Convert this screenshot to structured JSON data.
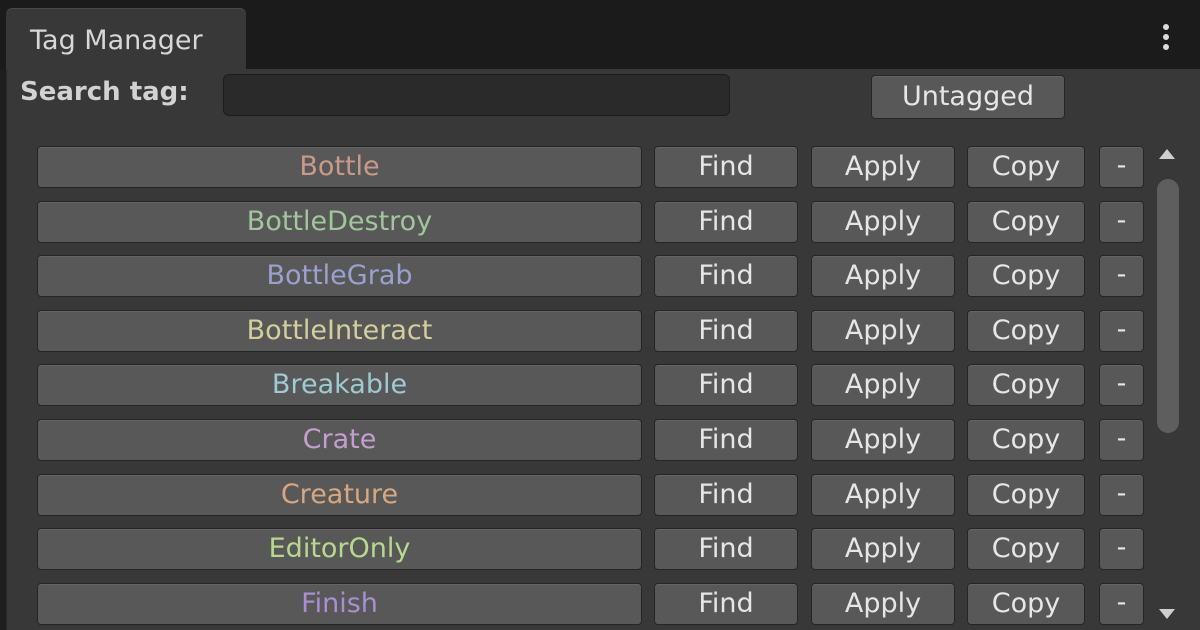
{
  "window": {
    "tab_title": "Tag Manager",
    "menu_icon": "kebab-menu-icon"
  },
  "search": {
    "label": "Search tag:",
    "value": "",
    "placeholder": ""
  },
  "untagged_button": "Untagged",
  "actions": {
    "find": "Find",
    "apply": "Apply",
    "copy": "Copy",
    "remove": "-"
  },
  "tags": [
    {
      "name": "Bottle",
      "color": "#c99a8a"
    },
    {
      "name": "BottleDestroy",
      "color": "#9fc79a"
    },
    {
      "name": "BottleGrab",
      "color": "#9aa1cf"
    },
    {
      "name": "BottleInteract",
      "color": "#d2cf9c"
    },
    {
      "name": "Breakable",
      "color": "#9fcad2"
    },
    {
      "name": "Crate",
      "color": "#c39fcf"
    },
    {
      "name": "Creature",
      "color": "#d8a77f"
    },
    {
      "name": "EditorOnly",
      "color": "#b7d98c"
    },
    {
      "name": "Finish",
      "color": "#a88fd2"
    }
  ],
  "scrollbar": {
    "up_icon": "scroll-up-arrow-icon",
    "down_icon": "scroll-down-arrow-icon"
  }
}
